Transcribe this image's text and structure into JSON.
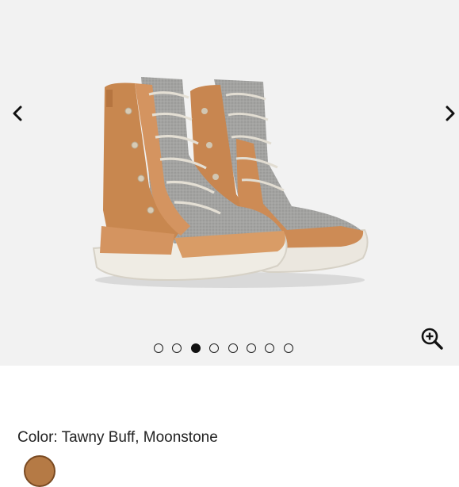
{
  "gallery": {
    "prev_icon": "chevron-left-icon",
    "next_icon": "chevron-right-icon",
    "zoom_icon": "zoom-in-icon",
    "image_alt": "Tawny Buff, Moonstone boots",
    "dots": [
      {
        "active": false
      },
      {
        "active": false
      },
      {
        "active": true
      },
      {
        "active": false
      },
      {
        "active": false
      },
      {
        "active": false
      },
      {
        "active": false
      },
      {
        "active": false
      }
    ],
    "active_index": 3,
    "total": 8
  },
  "product": {
    "color_label": "Color: Tawny Buff, Moonstone"
  },
  "colors": {
    "background_gallery": "#f2f2f2",
    "suede": "#c8874f",
    "felt": "#9a9a98",
    "sole": "#e9e5dc"
  }
}
